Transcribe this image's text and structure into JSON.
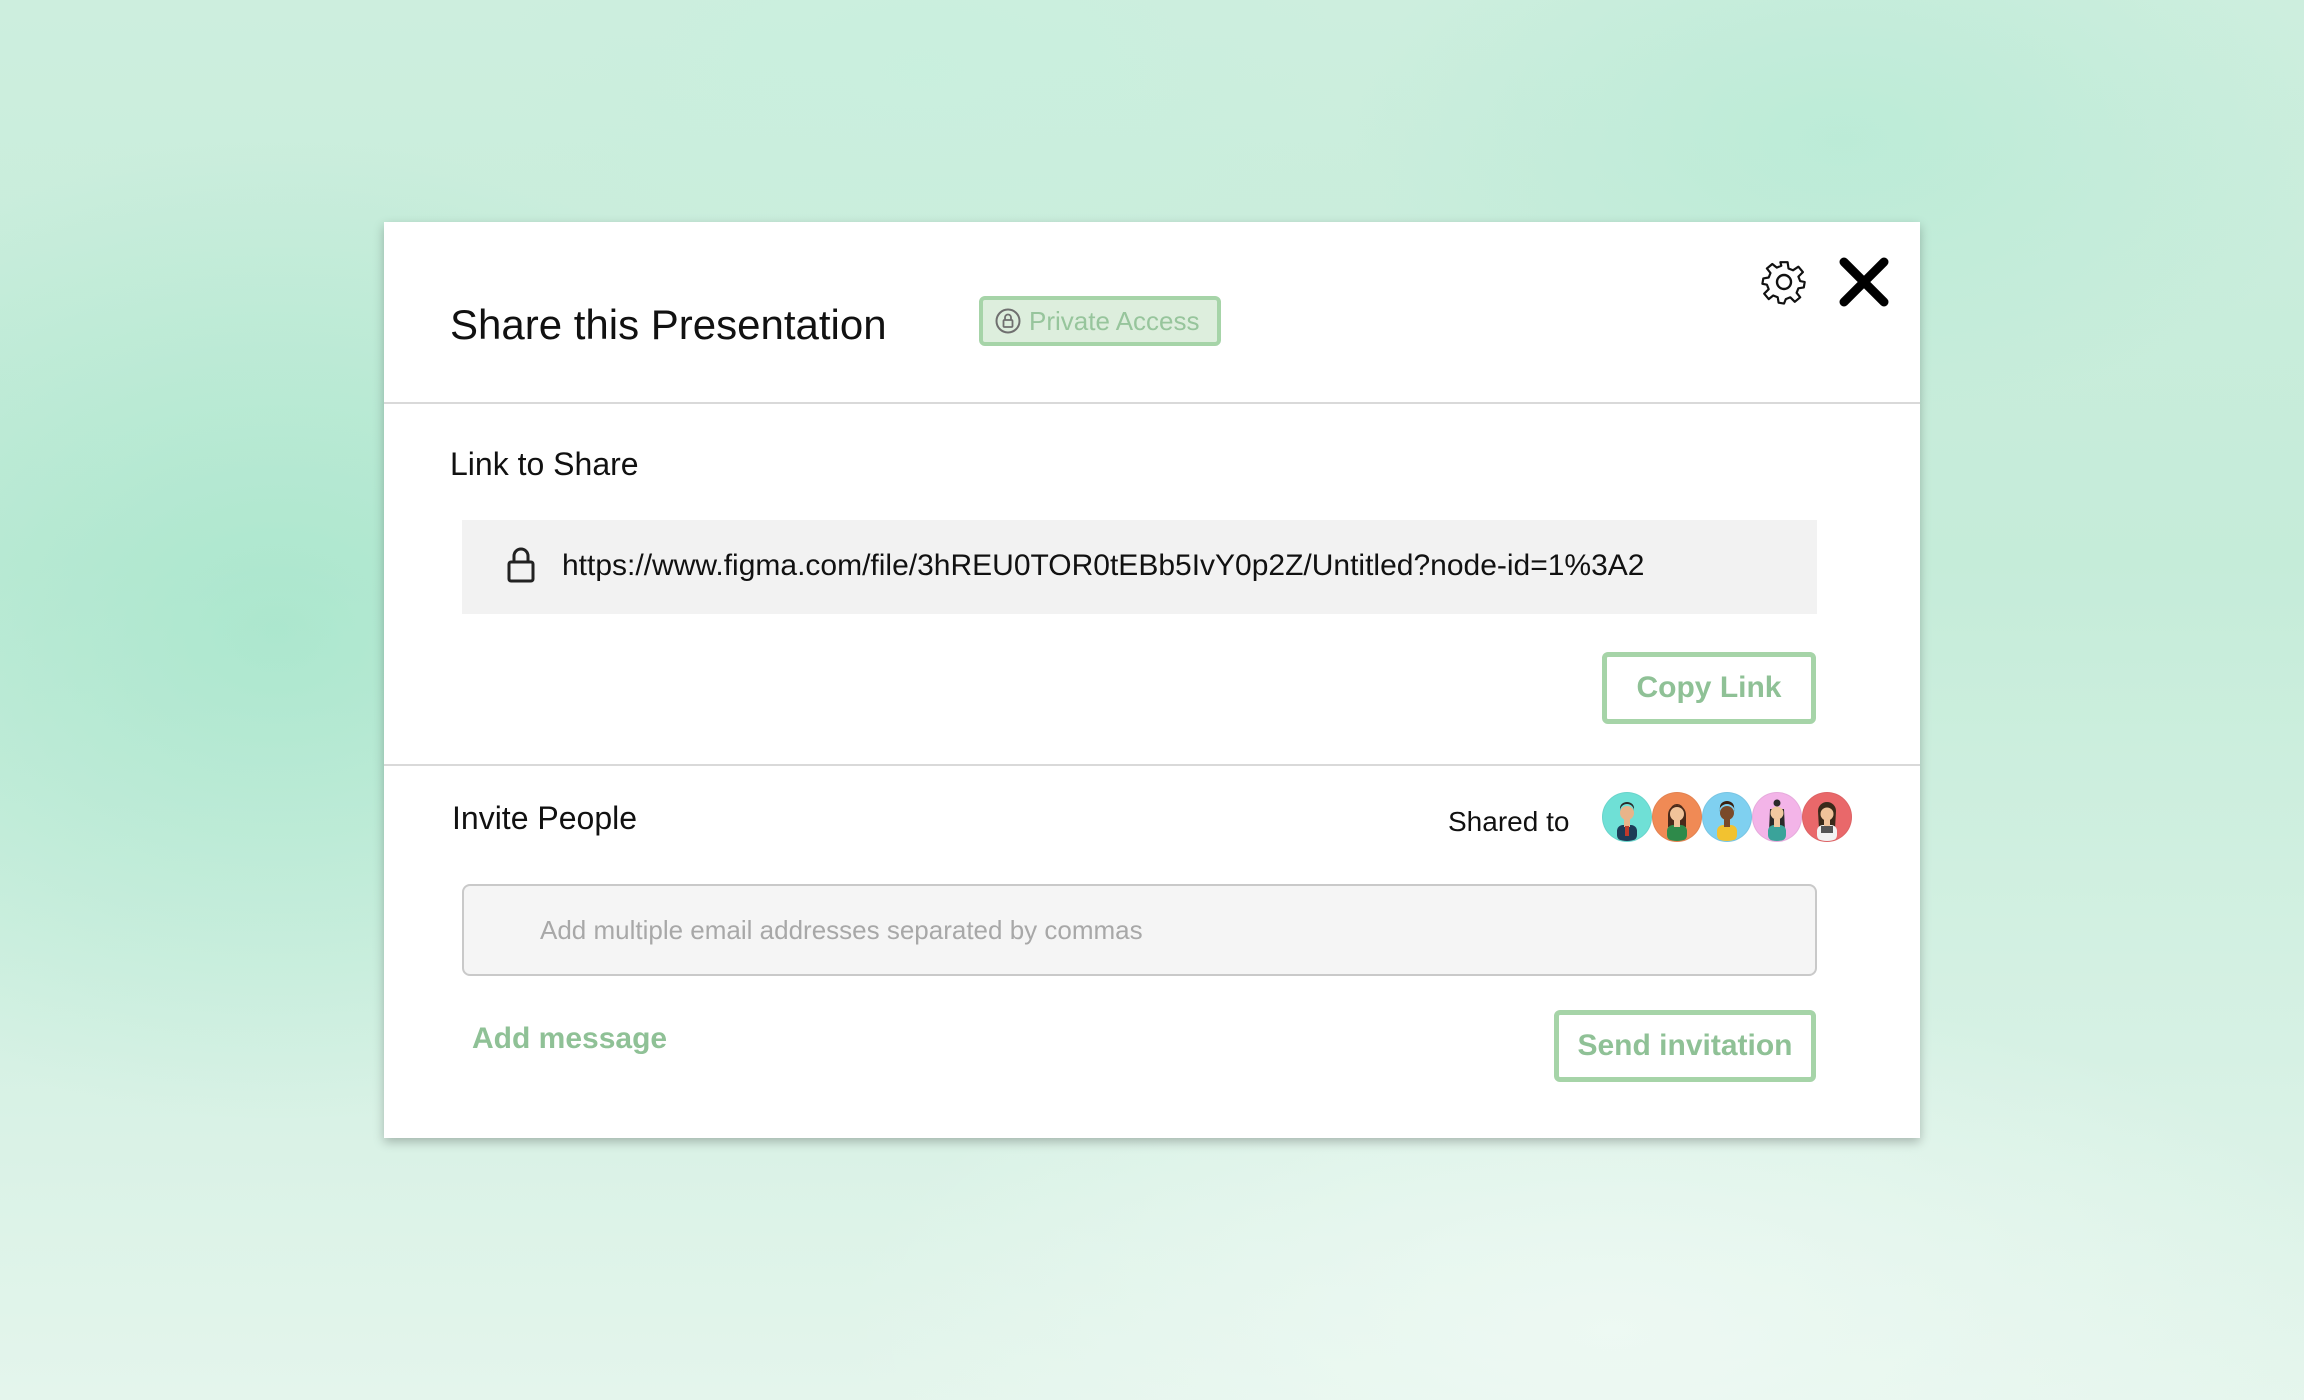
{
  "dialog": {
    "title": "Share this Presentation",
    "access_badge": {
      "label": "Private Access",
      "icon": "lock-circle-icon"
    },
    "settings_icon": "gear-icon",
    "close_icon": "close-icon"
  },
  "link_section": {
    "label": "Link to Share",
    "lock_icon": "lock-icon",
    "url": "https://www.figma.com/file/3hREU0TOR0tEBb5IvY0p2Z/Untitled?node-id=1%3A2",
    "copy_button_label": "Copy Link"
  },
  "invite_section": {
    "label": "Invite People",
    "shared_to_label": "Shared to",
    "avatars": [
      {
        "name": "avatar-1",
        "bg": "#6fe0d6",
        "skin": "#e8b48a",
        "shirt": "#1d3b57",
        "hair": "#2b2b2b"
      },
      {
        "name": "avatar-2",
        "bg": "#f08a55",
        "skin": "#f0c39a",
        "shirt": "#2e8a4a",
        "hair": "#4a2a1a"
      },
      {
        "name": "avatar-3",
        "bg": "#7fd0f0",
        "skin": "#7a4a2a",
        "shirt": "#f2c230",
        "hair": "#3a2010"
      },
      {
        "name": "avatar-4",
        "bg": "#f3b4e8",
        "skin": "#f0c8a0",
        "shirt": "#3aa39a",
        "hair": "#2a2a2a"
      },
      {
        "name": "avatar-5",
        "bg": "#e9686a",
        "skin": "#f0c39a",
        "shirt": "#f2f2f2",
        "hair": "#3a2a1a"
      }
    ],
    "email_placeholder": "Add multiple email addresses separated by commas",
    "email_value": "",
    "add_message_label": "Add message",
    "send_button_label": "Send invitation"
  },
  "colors": {
    "accent_green": "#8fc196",
    "accent_border": "#a6d4a8",
    "badge_bg": "#ddeedd",
    "background_mint": "#c5ecd9"
  }
}
